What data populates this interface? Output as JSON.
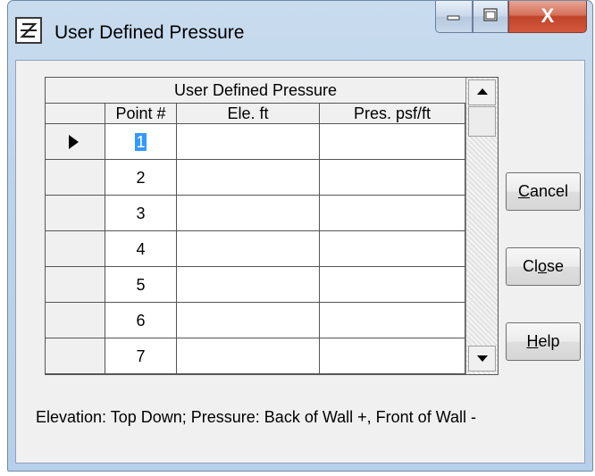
{
  "window": {
    "title": "User Defined Pressure",
    "controls": {
      "minimize": "minimize",
      "maximize": "maximize",
      "close": "X"
    }
  },
  "grid": {
    "caption": "User Defined Pressure",
    "columns": [
      "Point #",
      "Ele. ft",
      "Pres. psf/ft"
    ],
    "rows": [
      {
        "point": "1",
        "elevation": "",
        "pressure": "",
        "current": true
      },
      {
        "point": "2",
        "elevation": "",
        "pressure": ""
      },
      {
        "point": "3",
        "elevation": "",
        "pressure": ""
      },
      {
        "point": "4",
        "elevation": "",
        "pressure": ""
      },
      {
        "point": "5",
        "elevation": "",
        "pressure": ""
      },
      {
        "point": "6",
        "elevation": "",
        "pressure": ""
      },
      {
        "point": "7",
        "elevation": "",
        "pressure": ""
      }
    ]
  },
  "buttons": {
    "cancel": {
      "mn": "C",
      "rest": "ancel"
    },
    "close": {
      "pre": "Cl",
      "mn": "o",
      "rest": "se"
    },
    "help": {
      "mn": "H",
      "rest": "elp"
    }
  },
  "footer": "Elevation: Top Down; Pressure: Back of Wall +, Front of Wall -",
  "colors": {
    "selection": "#3399ff",
    "titlebar": "#bdd3ea",
    "close_button": "#c0442a"
  }
}
